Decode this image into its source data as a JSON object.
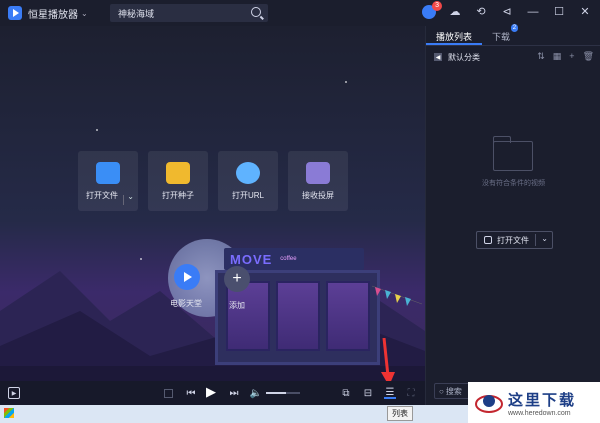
{
  "titlebar": {
    "app_title": "恒星播放器",
    "search_value": "神秘海域",
    "notification_count": "3"
  },
  "quick_actions": [
    {
      "label": "打开文件",
      "color": "#3a8ef6",
      "icon": "folder-icon"
    },
    {
      "label": "打开种子",
      "color": "#f0b92e",
      "icon": "torrent-icon"
    },
    {
      "label": "打开URL",
      "color": "#5fb3ff",
      "icon": "star-icon"
    },
    {
      "label": "接收投屏",
      "color": "#8a7bd6",
      "icon": "cast-icon"
    }
  ],
  "scene": {
    "sign_move": "MOVE",
    "sign_coffee": "coffee",
    "movie_label": "电影天堂",
    "add_label": "添加"
  },
  "side_panel": {
    "tab_playlist": "播放列表",
    "tab_download": "下载",
    "download_badge": "2",
    "category": "默认分类",
    "empty_text": "没有符合条件的视频",
    "open_file": "打开文件",
    "search_label": "搜索"
  },
  "controls": {
    "tooltip": "列表",
    "volume_level": 0.6
  },
  "watermark": {
    "title": "这里下载",
    "url": "www.heredown.com"
  }
}
